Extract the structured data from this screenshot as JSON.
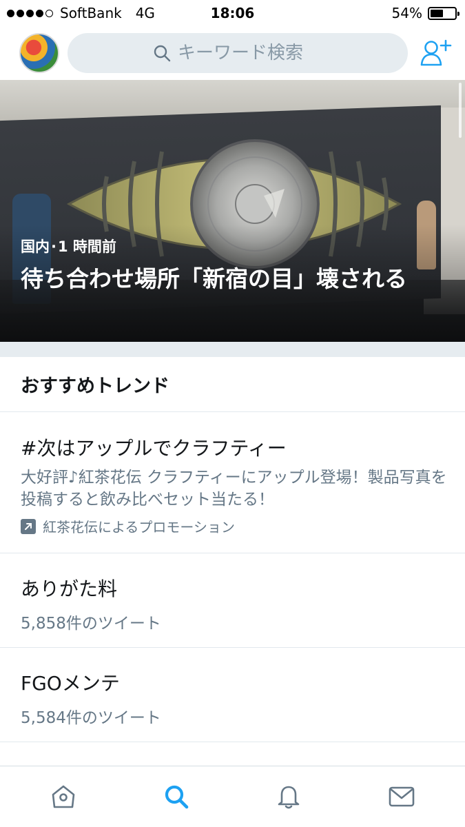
{
  "status_bar": {
    "carrier": "SoftBank",
    "network": "4G",
    "time": "18:06",
    "battery": "54%",
    "battery_level": 0.54
  },
  "header": {
    "search_placeholder": "キーワード検索",
    "icons": {
      "avatar": "profile-avatar",
      "search": "search-icon",
      "add_user": "add-user-icon"
    }
  },
  "hero": {
    "category": "国内",
    "time": "1 時間前",
    "separator": "·",
    "title": "待ち合わせ場所「新宿の目」壊される"
  },
  "trends": {
    "header": "おすすめトレンド",
    "items": [
      {
        "name": "#次はアップルでクラフティー",
        "description": "大好評♪紅茶花伝 クラフティーにアップル登場！製品写真を投稿すると飲み比べセット当たる！",
        "promotion": "紅茶花伝によるプロモーション"
      },
      {
        "name": "ありがた料",
        "count": "5,858件のツイート"
      },
      {
        "name": "FGOメンテ",
        "count": "5,584件のツイート"
      }
    ]
  },
  "tab_bar": {
    "tabs": [
      {
        "icon": "home-icon",
        "active": false
      },
      {
        "icon": "search-icon",
        "active": true
      },
      {
        "icon": "bell-icon",
        "active": false
      },
      {
        "icon": "mail-icon",
        "active": false
      }
    ]
  },
  "colors": {
    "accent": "#1da1f2",
    "secondary_text": "#657786",
    "search_bg": "#e6ecf0"
  }
}
